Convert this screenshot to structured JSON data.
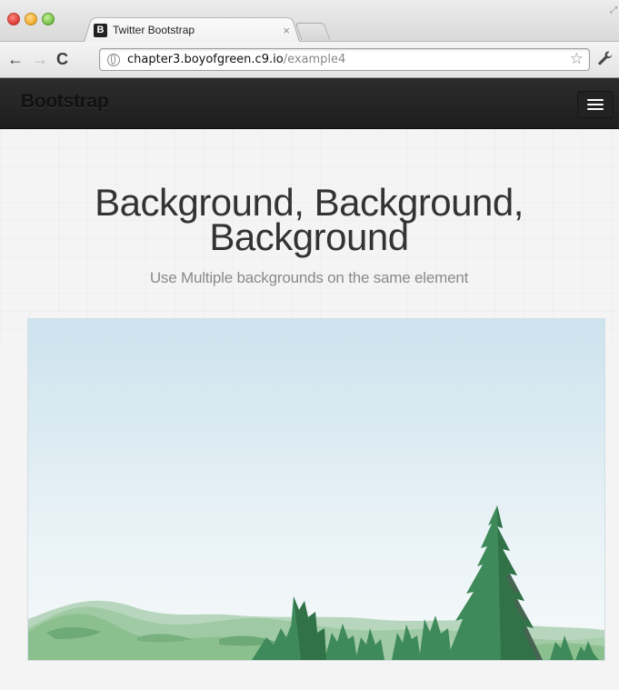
{
  "browser": {
    "tab": {
      "favicon_letter": "B",
      "title": "Twitter Bootstrap",
      "close_glyph": "×"
    },
    "address": {
      "host": "chapter3.boyofgreen.c9.io",
      "path": "/example4"
    },
    "nav": {
      "back_glyph": "←",
      "forward_glyph": "→",
      "reload_glyph": "C",
      "star_glyph": "☆",
      "wrench_glyph": "🔧"
    },
    "icons": {
      "close_window": "close-window-icon",
      "minimize_window": "minimize-window-icon",
      "maximize_window": "maximize-window-icon",
      "globe": "globe-icon",
      "star": "bookmark-star-icon",
      "wrench": "wrench-icon",
      "resize": "fullscreen-icon"
    }
  },
  "page": {
    "navbar": {
      "brand": "Bootstrap",
      "toggle_icon": "hamburger-menu-icon"
    },
    "headline_line1": "Background, Background,",
    "headline_line2": "Background",
    "subhead": "Use Multiple backgrounds on the same element",
    "hero_image": "sky-hills-trees-illustration",
    "colors": {
      "navbar": "#222222",
      "sky_top": "#cde3ee",
      "sky_bottom": "#f6f9fa",
      "tree_green": "#3f8a5a",
      "hill_green": "#8cbf8e"
    }
  }
}
